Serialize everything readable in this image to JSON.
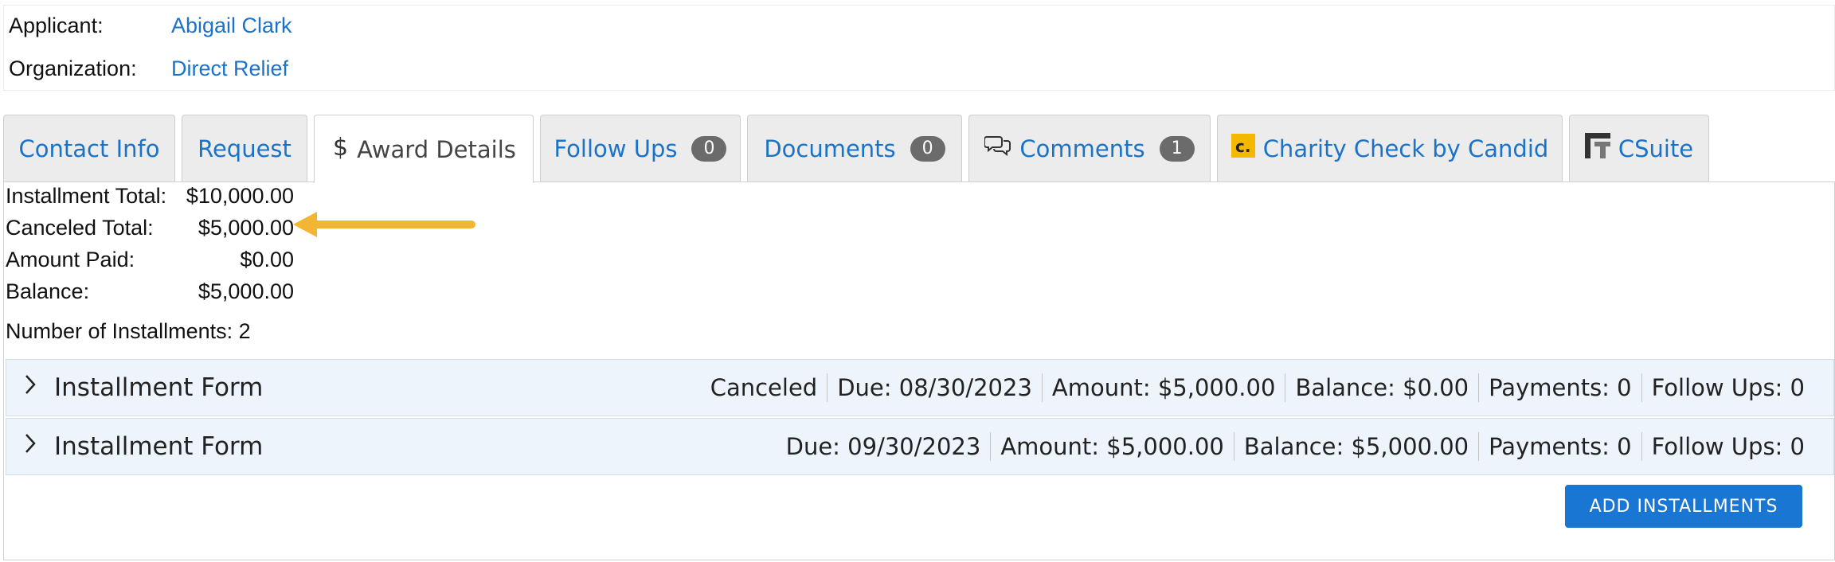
{
  "header": {
    "applicant_label": "Applicant:",
    "applicant_name": "Abigail Clark",
    "organization_label": "Organization:",
    "organization_name": "Direct Relief"
  },
  "tabs": [
    {
      "label": "Contact Info"
    },
    {
      "label": "Request"
    },
    {
      "label": "Award Details",
      "icon": "dollar-icon"
    },
    {
      "label": "Follow Ups",
      "badge": "0"
    },
    {
      "label": "Documents",
      "badge": "0"
    },
    {
      "label": "Comments",
      "badge": "1",
      "icon": "comments-icon"
    },
    {
      "label": "Charity Check by Candid",
      "icon": "candid-logo-icon"
    },
    {
      "label": "CSuite",
      "icon": "csuite-logo-icon"
    }
  ],
  "summary": {
    "installment_total_label": "Installment Total:",
    "installment_total": "$10,000.00",
    "canceled_total_label": "Canceled Total:",
    "canceled_total": "$5,000.00",
    "amount_paid_label": "Amount Paid:",
    "amount_paid": "$0.00",
    "balance_label": "Balance:",
    "balance": "$5,000.00",
    "num_installments": "Number of Installments: 2"
  },
  "installments": [
    {
      "title": "Installment Form",
      "status": "Canceled",
      "due": "Due: 08/30/2023",
      "amount": "Amount: $5,000.00",
      "balance": "Balance: $0.00",
      "payments": "Payments: 0",
      "follow_ups": "Follow Ups: 0"
    },
    {
      "title": "Installment Form",
      "due": "Due: 09/30/2023",
      "amount": "Amount: $5,000.00",
      "balance": "Balance: $5,000.00",
      "payments": "Payments: 0",
      "follow_ups": "Follow Ups: 0"
    }
  ],
  "add_button_label": "ADD INSTALLMENTS",
  "colors": {
    "link": "#1a73c9",
    "annotation_arrow": "#f2b632",
    "button": "#1976d2",
    "badge": "#6b6b6b",
    "accordion_bg": "#eef4fb"
  }
}
